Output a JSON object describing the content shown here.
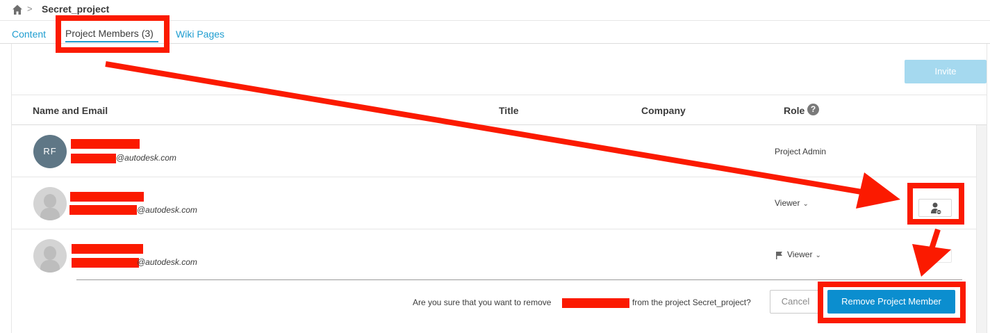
{
  "breadcrumb": {
    "separator": ">",
    "project": "Secret_project"
  },
  "tabs": [
    {
      "label": "Content"
    },
    {
      "label": "Project Members (3)",
      "active": true
    },
    {
      "label": "Wiki Pages"
    }
  ],
  "toolbar": {
    "invite_label": "Invite"
  },
  "table": {
    "headers": {
      "name_email": "Name and Email",
      "title": "Title",
      "company": "Company",
      "role": "Role",
      "help": "?"
    },
    "rows": [
      {
        "initials": "RF",
        "email_suffix": "@autodesk.com",
        "role": "Project Admin"
      },
      {
        "email_suffix": "@autodesk.com",
        "role": "Viewer"
      },
      {
        "email_suffix": "@autodesk.com",
        "role": "Viewer"
      }
    ]
  },
  "confirm": {
    "text_before": "Are you sure that you want to remove",
    "text_after": "from the project Secret_project?",
    "cancel_label": "Cancel",
    "remove_label": "Remove Project Member"
  },
  "colors": {
    "accent": "#1e9dd0",
    "primary_button": "#0b8ecf",
    "annotation": "#fb1a00",
    "redaction": "#fb1a00"
  },
  "icons": {
    "home": "home-icon",
    "help": "question-icon",
    "remove_member": "remove-user-icon",
    "flag": "flag-icon",
    "chevron": "chevron-down-icon"
  }
}
